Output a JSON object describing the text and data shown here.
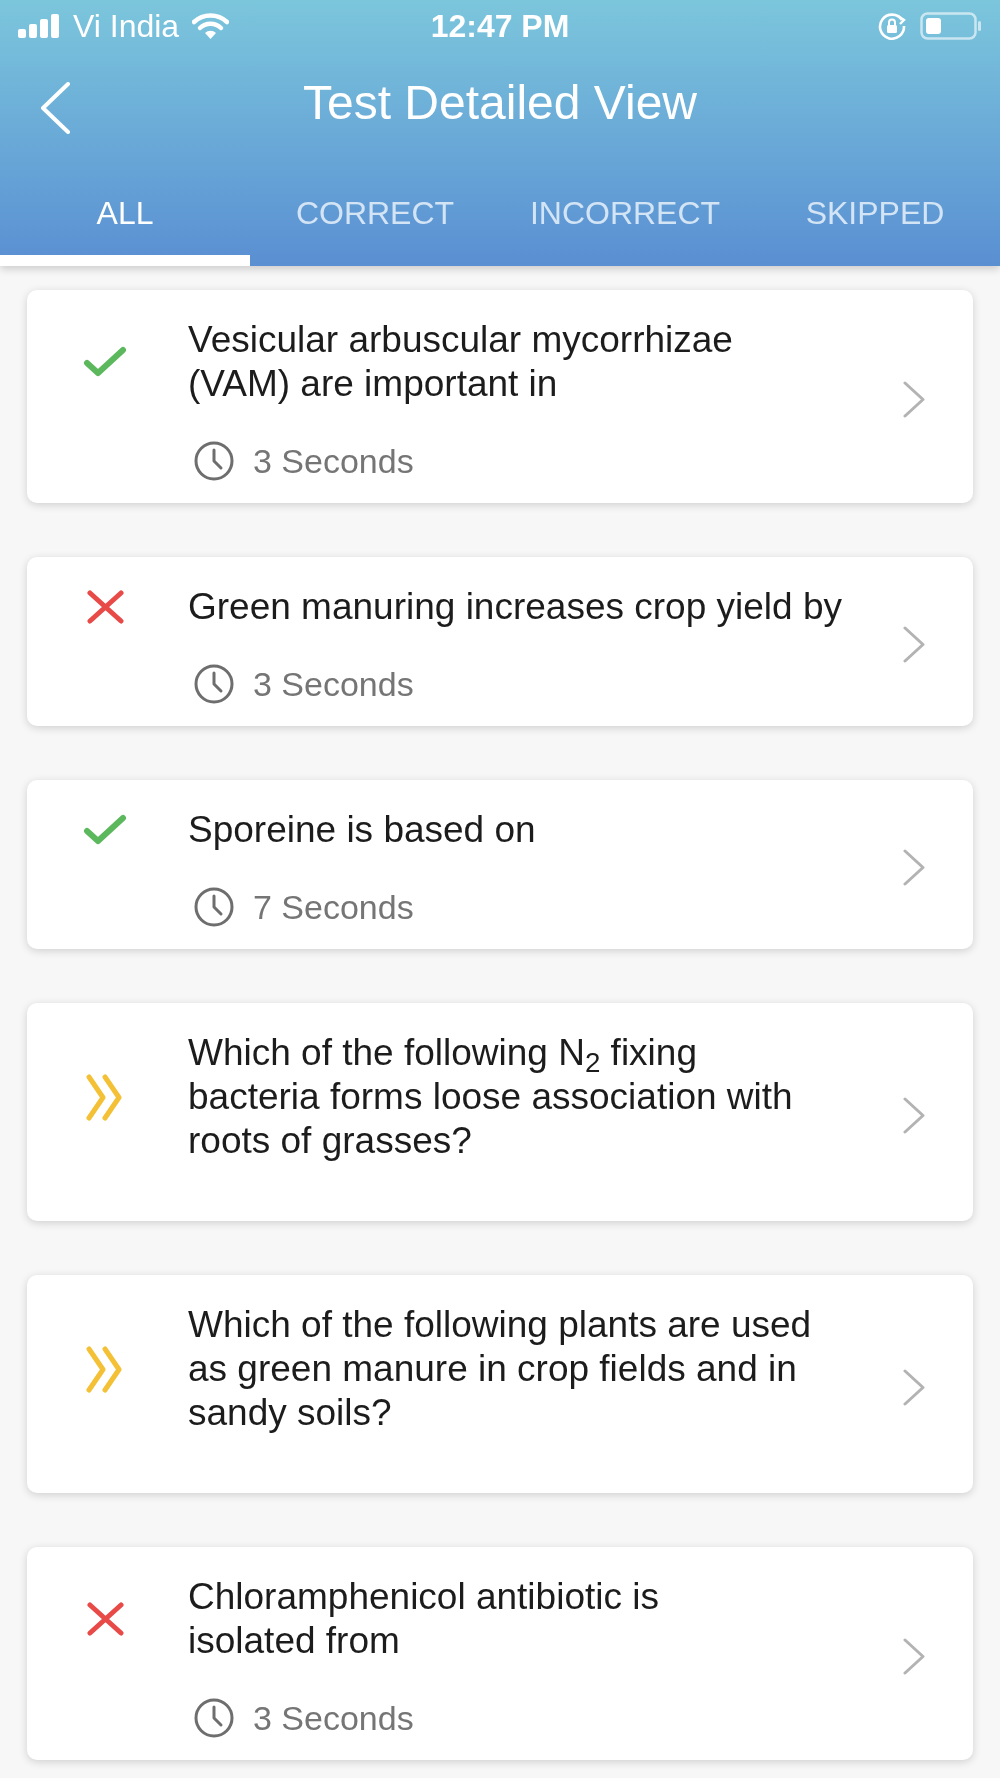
{
  "status_bar": {
    "carrier": "Vi India",
    "time": "12:47 PM"
  },
  "header": {
    "title": "Test Detailed View"
  },
  "tabs": [
    {
      "label": "ALL",
      "selected": true
    },
    {
      "label": "CORRECT",
      "selected": false
    },
    {
      "label": "INCORRECT",
      "selected": false
    },
    {
      "label": "SKIPPED",
      "selected": false
    }
  ],
  "questions": [
    {
      "kind": "correct",
      "text": "Vesicular arbuscular mycorrhizae\n(VAM) are important in",
      "time": "3 Seconds"
    },
    {
      "kind": "incorrect",
      "text": "Green manuring increases crop yield by",
      "time": "3 Seconds"
    },
    {
      "kind": "correct",
      "text": "Sporeine is based on",
      "time": "7 Seconds"
    },
    {
      "kind": "skipped",
      "text": "Which of the following N$_{2}$ fixing\nbacteria forms loose association with\nroots of grasses?"
    },
    {
      "kind": "skipped",
      "text": "Which of the following plants are used\nas green manure in crop fields and in\nsandy soils?"
    },
    {
      "kind": "incorrect",
      "text": "Chloramphenicol antibiotic is\nisolated from",
      "time": "3 Seconds"
    }
  ]
}
